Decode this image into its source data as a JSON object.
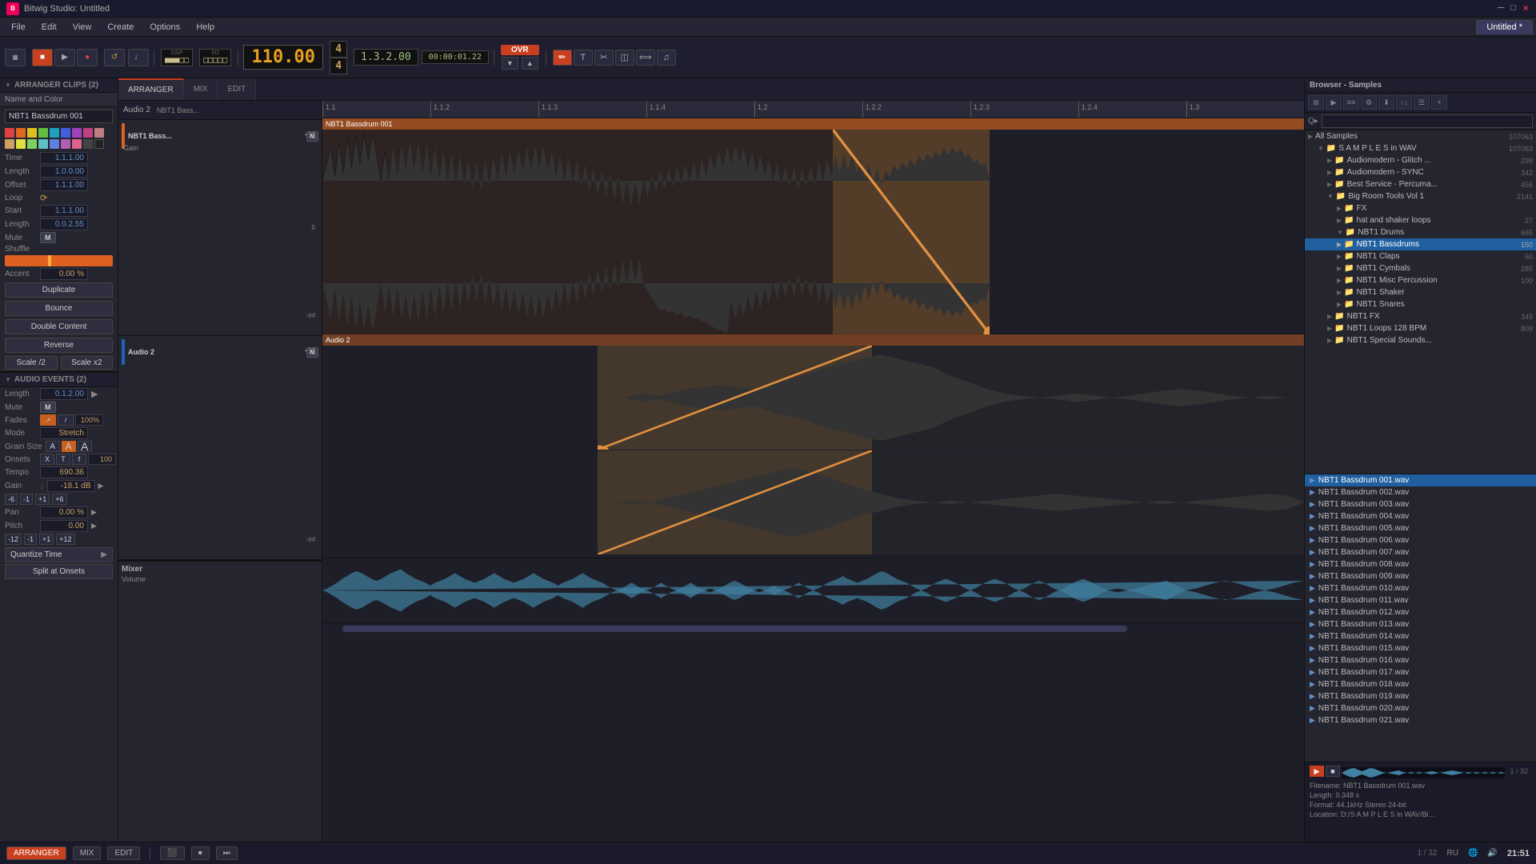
{
  "app": {
    "title": "Bitwig Studio: Untitled",
    "name": "Bitwig Studio"
  },
  "titlebar": {
    "title": "Bitwig Studio: Untitled"
  },
  "menubar": {
    "items": [
      "File",
      "Edit",
      "View",
      "Create",
      "Options",
      "Help"
    ]
  },
  "transport": {
    "tempo": "110.00",
    "time_sig_top": "4",
    "time_sig_bottom": "4",
    "timecode": "1.3.2.00",
    "position": "00:00:01.22",
    "ovr": "OVR",
    "dsp_label": "DSP",
    "io_label": "I/O"
  },
  "tabs": {
    "active_tab": "Untitled *",
    "items": [
      "Untitled *"
    ]
  },
  "main_tabs": {
    "items": [
      "ARRANGER",
      "MIX",
      "EDIT"
    ],
    "active": "ARRANGER"
  },
  "left_panel": {
    "arranger_clips_header": "ARRANGER CLIPS (2)",
    "name_and_color_label": "Name and Color",
    "clip_name": "NBT1 Bassdrum 001",
    "colors": [
      "#e04040",
      "#e06820",
      "#e0c020",
      "#60c040",
      "#20a0c0",
      "#4060e0",
      "#a040c0",
      "#c04080",
      "#c08080",
      "#d0a060",
      "#e0e040",
      "#80d060",
      "#60c0c0",
      "#6080e0",
      "#b060b0",
      "#e06090",
      "#444",
      "#222"
    ],
    "props": {
      "time_label": "Time",
      "time_value": "1.1.1.00",
      "length_label": "Length",
      "length_value": "1.0.0.00",
      "offset_label": "Offset",
      "offset_value": "1.1.1.00",
      "loop_label": "Loop",
      "start_label": "Start",
      "start_value": "1.1.1.00",
      "loop_length_label": "Length",
      "loop_length_value": "0.0.2.55",
      "mute_label": "Mute",
      "mute_value": "M",
      "shuffle_label": "Shuffle",
      "accent_label": "Accent",
      "accent_value": "0.00 %"
    },
    "buttons": {
      "duplicate": "Duplicate",
      "bounce": "Bounce",
      "double_content": "Double Content",
      "reverse": "Reverse",
      "scale_half": "Scale /2",
      "scale_double": "Scale x2"
    },
    "audio_events_header": "AUDIO EVENTS (2)",
    "audio_events": {
      "length_label": "Length",
      "length_value": "0.1.2.00",
      "mute_label": "Mute",
      "mute_value": "M",
      "fades_label": "Fades",
      "mode_label": "Mode",
      "mode_value": "Stretch",
      "grain_size_label": "Grain Size",
      "onsets_label": "Onsets",
      "tempo_label": "Tempo",
      "tempo_value": "690.36",
      "gain_label": "Gain",
      "gain_value": "-18.1 dB",
      "pan_label": "Pan",
      "pan_value": "0.00 %",
      "pitch_label": "Pitch",
      "pitch_value": "0.00",
      "quantize_btn": "Quantize Time",
      "split_btn": "Split at Onsets"
    }
  },
  "arranger": {
    "tracks": [
      {
        "name": "Audio 2",
        "sub_name": "NBT1 Bass...",
        "clip_name": "NBT1 Bassdrum 001",
        "gain_label": "Gain",
        "color": "#e06020"
      },
      {
        "name": "Audio 2",
        "color": "#2060c0"
      }
    ],
    "ruler": {
      "marks": [
        "1.1",
        "1.1.2",
        "1.1.3",
        "1.1.4",
        "1.2",
        "1.2.2",
        "1.2.3",
        "1.2.4",
        "1.3"
      ]
    },
    "mixer": {
      "name": "Mixer",
      "volume_label": "Volume"
    }
  },
  "browser": {
    "header": "Browser - Samples",
    "search_placeholder": "Q▸",
    "all_samples_label": "All Samples",
    "all_samples_count": "107063",
    "tree": [
      {
        "label": "S A M P L E S in WAV",
        "count": "107063",
        "level": 1,
        "expanded": true,
        "type": "folder"
      },
      {
        "label": "Audiomodern - Glitch ...",
        "count": "299",
        "level": 2,
        "type": "folder"
      },
      {
        "label": "Audiomodern - SYNC",
        "count": "342",
        "level": 2,
        "type": "folder"
      },
      {
        "label": "Best Service - Percuma...",
        "count": "456",
        "level": 2,
        "type": "folder"
      },
      {
        "label": "Big Room Tools Vol 1",
        "count": "2141",
        "level": 2,
        "expanded": true,
        "type": "folder"
      },
      {
        "label": "FX",
        "count": "",
        "level": 3,
        "type": "folder"
      },
      {
        "label": "hat and shaker loops",
        "count": "27",
        "level": 3,
        "type": "folder"
      },
      {
        "label": "NBT1 Drums",
        "count": "665",
        "level": 3,
        "expanded": true,
        "type": "folder"
      },
      {
        "label": "NBT1 Bassdrums",
        "count": "150",
        "level": 4,
        "type": "folder",
        "selected": true
      },
      {
        "label": "NBT1 Claps",
        "count": "50",
        "level": 4,
        "type": "folder"
      },
      {
        "label": "NBT1 Cymbals",
        "count": "285",
        "level": 4,
        "type": "folder"
      },
      {
        "label": "NBT1 Misc Percussion",
        "count": "100",
        "level": 4,
        "type": "folder"
      },
      {
        "label": "NBT1 Shaker",
        "count": "",
        "level": 4,
        "type": "folder"
      },
      {
        "label": "NBT1 Snares",
        "count": "",
        "level": 4,
        "type": "folder"
      },
      {
        "label": "NBT1 FX",
        "count": "349",
        "level": 3,
        "type": "folder"
      },
      {
        "label": "NBT1 Loops 128 BPM",
        "count": "809",
        "level": 3,
        "type": "folder"
      },
      {
        "label": "NBT1 Special Sounds...",
        "count": "",
        "level": 3,
        "type": "folder"
      }
    ],
    "files": [
      {
        "name": "NBT1 Bassdrum 001.wav",
        "selected": true
      },
      {
        "name": "NBT1 Bassdrum 002.wav"
      },
      {
        "name": "NBT1 Bassdrum 003.wav"
      },
      {
        "name": "NBT1 Bassdrum 004.wav"
      },
      {
        "name": "NBT1 Bassdrum 005.wav"
      },
      {
        "name": "NBT1 Bassdrum 006.wav"
      },
      {
        "name": "NBT1 Bassdrum 007.wav"
      },
      {
        "name": "NBT1 Bassdrum 008.wav"
      },
      {
        "name": "NBT1 Bassdrum 009.wav"
      },
      {
        "name": "NBT1 Bassdrum 010.wav"
      },
      {
        "name": "NBT1 Bassdrum 011.wav"
      },
      {
        "name": "NBT1 Bassdrum 012.wav"
      },
      {
        "name": "NBT1 Bassdrum 013.wav"
      },
      {
        "name": "NBT1 Bassdrum 014.wav"
      },
      {
        "name": "NBT1 Bassdrum 015.wav"
      },
      {
        "name": "NBT1 Bassdrum 016.wav"
      },
      {
        "name": "NBT1 Bassdrum 017.wav"
      },
      {
        "name": "NBT1 Bassdrum 018.wav"
      },
      {
        "name": "NBT1 Bassdrum 019.wav"
      },
      {
        "name": "NBT1 Bassdrum 020.wav"
      },
      {
        "name": "NBT1 Bassdrum 021.wav"
      }
    ],
    "preview": {
      "filename": "Filename: NBT1 Bassdrum 001.wav",
      "length": "Length: 0.348 s",
      "format": "Format: 44.1kHz Stereo 24-bit",
      "location": "Location: D:/S A M P L E S in WAV/Bi..."
    },
    "page_info": "1 / 32"
  },
  "statusbar": {
    "tabs": [
      "ARRANGER",
      "MIX",
      "EDIT"
    ],
    "icons": [
      "⬛",
      "⏺",
      "⏭"
    ],
    "page": "1/32",
    "time": "21:51",
    "locale": "RU"
  }
}
